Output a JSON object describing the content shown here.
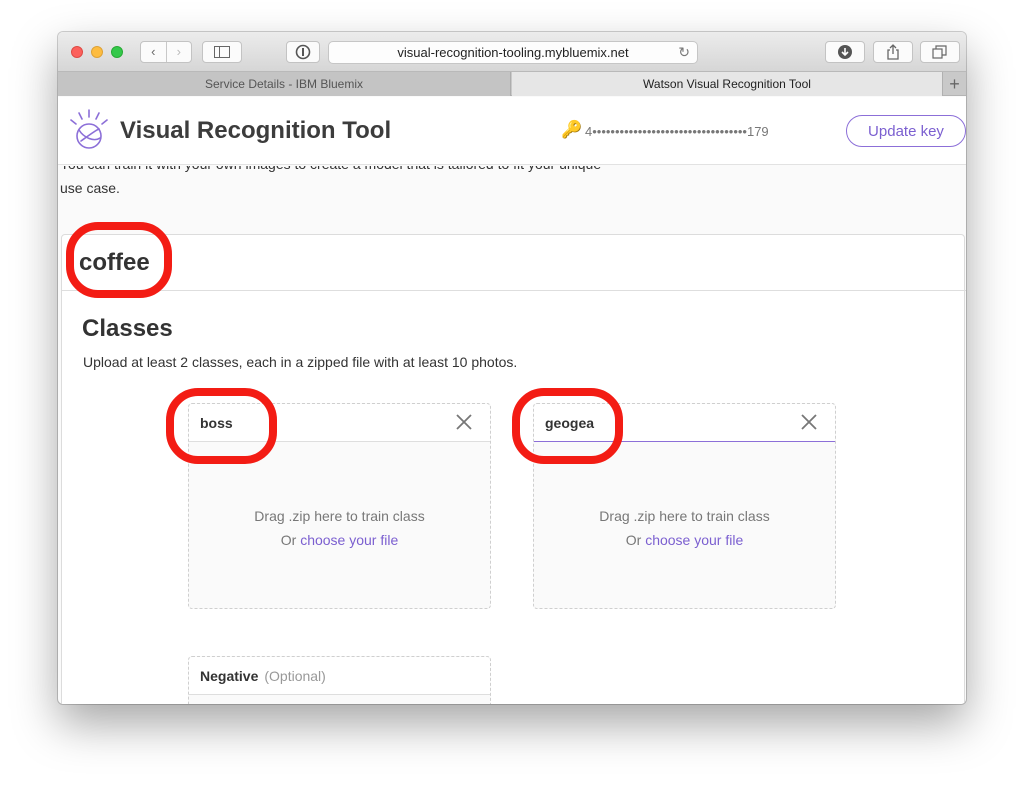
{
  "browser": {
    "url": "visual-recognition-tooling.mybluemix.net",
    "tabs": [
      {
        "label": "Service Details - IBM Bluemix",
        "active": false
      },
      {
        "label": "Watson Visual Recognition Tool",
        "active": true
      }
    ],
    "new_tab_label": "+",
    "reload_icon": "reload-icon"
  },
  "header": {
    "title": "Visual Recognition Tool",
    "api_key_masked": "4••••••••••••••••••••••••••••••••••179",
    "update_key_label": "Update key",
    "key_icon_color": "#e3a51b",
    "accent_color": "#7b5fd0"
  },
  "intro": {
    "line1": "You can train it with your own images to create a model that is tailored to fit your unique",
    "line2": "use case."
  },
  "classifier": {
    "name": "coffee",
    "classes_heading": "Classes",
    "classes_instructions": "Upload at least 2 classes, each in a zipped file with at least 10 photos.",
    "classes": [
      {
        "name": "boss",
        "drop_text": "Drag .zip here to train class",
        "or_text": "Or",
        "choose_text": "choose your file"
      },
      {
        "name": "geogea",
        "drop_text": "Drag .zip here to train class",
        "or_text": "Or",
        "choose_text": "choose your file"
      }
    ],
    "negative": {
      "label": "Negative",
      "optional_label": "(Optional)"
    }
  },
  "annotation_color": "#f31c14"
}
